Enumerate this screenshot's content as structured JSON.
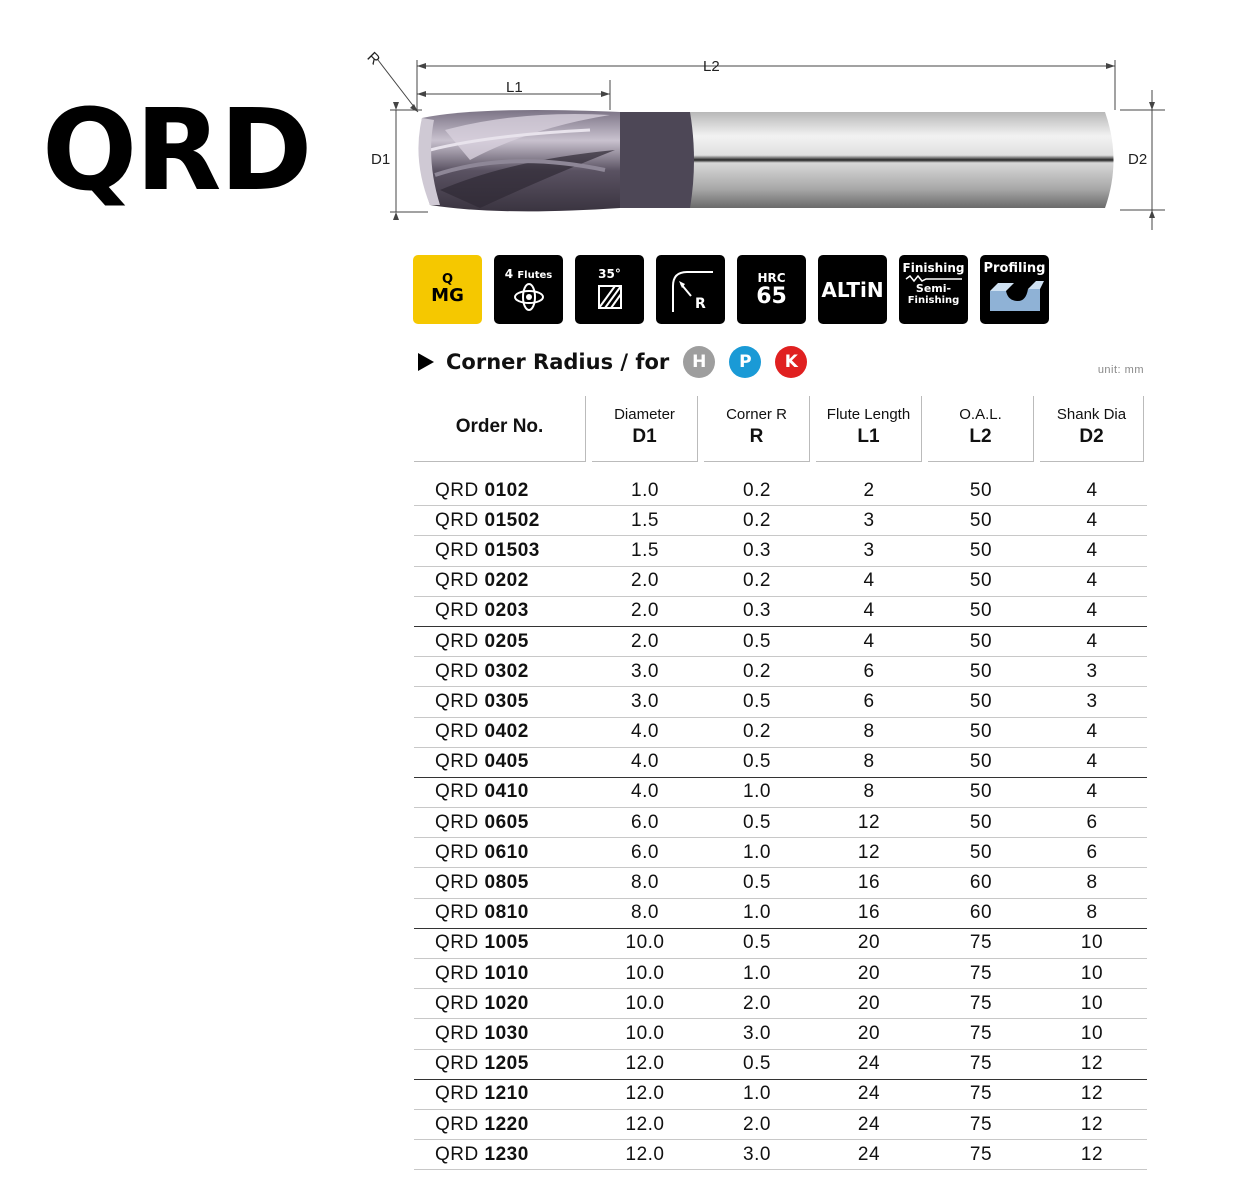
{
  "title": "QRD",
  "drawing_labels": {
    "r": "R",
    "l1": "L1",
    "l2": "L2",
    "d1": "D1",
    "d2": "D2"
  },
  "badges": [
    {
      "name": "qmg-badge",
      "line1": "Q",
      "line2": "MG",
      "color": "#f5c800"
    },
    {
      "name": "flutes-badge",
      "line1": "4",
      "line2": "Flutes"
    },
    {
      "name": "helix-badge",
      "line1": "35°"
    },
    {
      "name": "corner-radius-badge",
      "line1": "R"
    },
    {
      "name": "hardness-badge",
      "line1": "HRC",
      "line2": "65"
    },
    {
      "name": "coating-badge",
      "line1": "ALTiN"
    },
    {
      "name": "finishing-badge",
      "line1": "Finishing",
      "line2": "Semi-",
      "line3": "Finishing"
    },
    {
      "name": "profiling-badge",
      "line1": "Profiling"
    }
  ],
  "section": {
    "heading": "Corner Radius / for",
    "materials": [
      {
        "label": "H",
        "color": "#9e9e9e"
      },
      {
        "label": "P",
        "color": "#1a9ad6"
      },
      {
        "label": "K",
        "color": "#e02020"
      }
    ],
    "unit": "unit: mm"
  },
  "table": {
    "headers": [
      {
        "label": "Order No.",
        "symbol": ""
      },
      {
        "label": "Diameter",
        "symbol": "D1"
      },
      {
        "label": "Corner R",
        "symbol": "R"
      },
      {
        "label": "Flute Length",
        "symbol": "L1"
      },
      {
        "label": "O.A.L.",
        "symbol": "L2"
      },
      {
        "label": "Shank Dia",
        "symbol": "D2"
      }
    ],
    "rows": [
      {
        "prefix": "QRD",
        "code": "0102",
        "d1": "1.0",
        "r": "0.2",
        "l1": "2",
        "l2": "50",
        "d2": "4"
      },
      {
        "prefix": "QRD",
        "code": "01502",
        "d1": "1.5",
        "r": "0.2",
        "l1": "3",
        "l2": "50",
        "d2": "4"
      },
      {
        "prefix": "QRD",
        "code": "01503",
        "d1": "1.5",
        "r": "0.3",
        "l1": "3",
        "l2": "50",
        "d2": "4"
      },
      {
        "prefix": "QRD",
        "code": "0202",
        "d1": "2.0",
        "r": "0.2",
        "l1": "4",
        "l2": "50",
        "d2": "4"
      },
      {
        "prefix": "QRD",
        "code": "0203",
        "d1": "2.0",
        "r": "0.3",
        "l1": "4",
        "l2": "50",
        "d2": "4"
      },
      {
        "prefix": "QRD",
        "code": "0205",
        "d1": "2.0",
        "r": "0.5",
        "l1": "4",
        "l2": "50",
        "d2": "4"
      },
      {
        "prefix": "QRD",
        "code": "0302",
        "d1": "3.0",
        "r": "0.2",
        "l1": "6",
        "l2": "50",
        "d2": "3"
      },
      {
        "prefix": "QRD",
        "code": "0305",
        "d1": "3.0",
        "r": "0.5",
        "l1": "6",
        "l2": "50",
        "d2": "3"
      },
      {
        "prefix": "QRD",
        "code": "0402",
        "d1": "4.0",
        "r": "0.2",
        "l1": "8",
        "l2": "50",
        "d2": "4"
      },
      {
        "prefix": "QRD",
        "code": "0405",
        "d1": "4.0",
        "r": "0.5",
        "l1": "8",
        "l2": "50",
        "d2": "4"
      },
      {
        "prefix": "QRD",
        "code": "0410",
        "d1": "4.0",
        "r": "1.0",
        "l1": "8",
        "l2": "50",
        "d2": "4"
      },
      {
        "prefix": "QRD",
        "code": "0605",
        "d1": "6.0",
        "r": "0.5",
        "l1": "12",
        "l2": "50",
        "d2": "6"
      },
      {
        "prefix": "QRD",
        "code": "0610",
        "d1": "6.0",
        "r": "1.0",
        "l1": "12",
        "l2": "50",
        "d2": "6"
      },
      {
        "prefix": "QRD",
        "code": "0805",
        "d1": "8.0",
        "r": "0.5",
        "l1": "16",
        "l2": "60",
        "d2": "8"
      },
      {
        "prefix": "QRD",
        "code": "0810",
        "d1": "8.0",
        "r": "1.0",
        "l1": "16",
        "l2": "60",
        "d2": "8"
      },
      {
        "prefix": "QRD",
        "code": "1005",
        "d1": "10.0",
        "r": "0.5",
        "l1": "20",
        "l2": "75",
        "d2": "10"
      },
      {
        "prefix": "QRD",
        "code": "1010",
        "d1": "10.0",
        "r": "1.0",
        "l1": "20",
        "l2": "75",
        "d2": "10"
      },
      {
        "prefix": "QRD",
        "code": "1020",
        "d1": "10.0",
        "r": "2.0",
        "l1": "20",
        "l2": "75",
        "d2": "10"
      },
      {
        "prefix": "QRD",
        "code": "1030",
        "d1": "10.0",
        "r": "3.0",
        "l1": "20",
        "l2": "75",
        "d2": "10"
      },
      {
        "prefix": "QRD",
        "code": "1205",
        "d1": "12.0",
        "r": "0.5",
        "l1": "24",
        "l2": "75",
        "d2": "12"
      },
      {
        "prefix": "QRD",
        "code": "1210",
        "d1": "12.0",
        "r": "1.0",
        "l1": "24",
        "l2": "75",
        "d2": "12"
      },
      {
        "prefix": "QRD",
        "code": "1220",
        "d1": "12.0",
        "r": "2.0",
        "l1": "24",
        "l2": "75",
        "d2": "12"
      },
      {
        "prefix": "QRD",
        "code": "1230",
        "d1": "12.0",
        "r": "3.0",
        "l1": "24",
        "l2": "75",
        "d2": "12"
      }
    ]
  }
}
